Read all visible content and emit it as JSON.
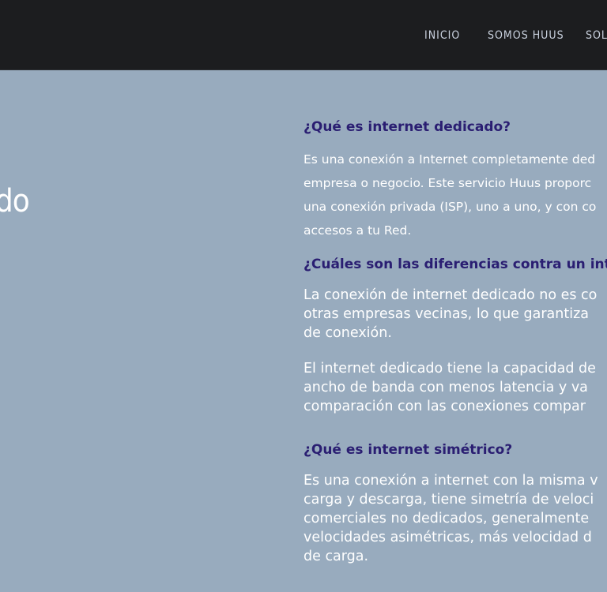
{
  "nav": {
    "items": [
      {
        "label": "INICIO"
      },
      {
        "label": "SOMOS HUUS"
      },
      {
        "label": "SOLU"
      }
    ]
  },
  "hero": {
    "title": "edicado"
  },
  "faq": [
    {
      "question": "¿Qué es internet dedicado?",
      "paragraphs": [
        [
          "Es una conexión a Internet completamente ded",
          "empresa o negocio. Este servicio Huus proporc",
          "una conexión privada (ISP), uno a uno, y con co",
          "accesos a tu Red."
        ]
      ]
    },
    {
      "question": "¿Cuáles son las diferencias contra un inte",
      "paragraphs": [
        [
          "La conexión de internet dedicado no es co",
          "otras empresas vecinas, lo que garantiza",
          "de conexión."
        ],
        [
          "El internet dedicado tiene la capacidad de",
          "ancho de banda con menos latencia y va",
          "comparación con las conexiones compar"
        ]
      ]
    },
    {
      "question": "¿Qué es internet simétrico?",
      "paragraphs": [
        [
          "Es una conexión a internet con la misma v",
          "carga y descarga, tiene simetría de veloci",
          "comerciales no dedicados, generalmente",
          "velocidades asimétricas, más velocidad d",
          "de carga."
        ]
      ]
    }
  ]
}
